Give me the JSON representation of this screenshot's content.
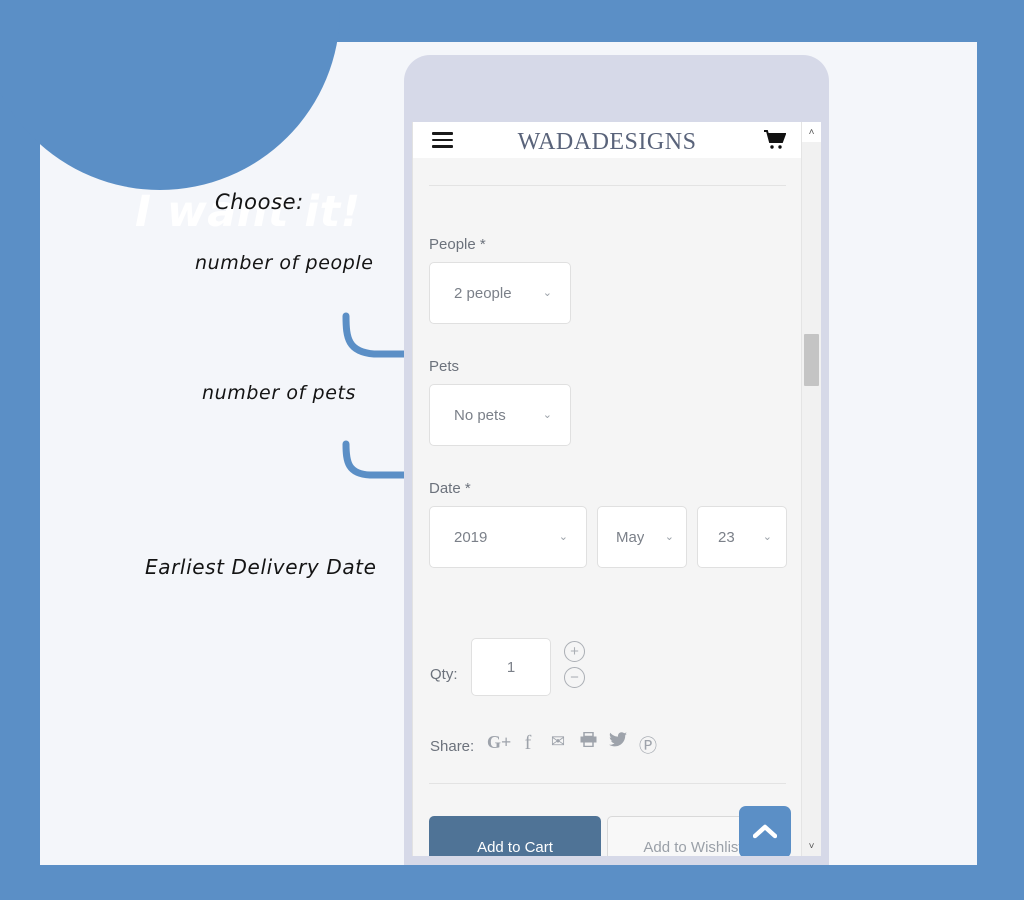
{
  "promo": {
    "bubble_text": "I want it!",
    "bubble_color": "#5B8FC6",
    "panel_color": "#F4F6FA"
  },
  "annotations": [
    {
      "id": "choose",
      "text": "Choose:"
    },
    {
      "id": "people",
      "text": "number of people"
    },
    {
      "id": "pets",
      "text": "number of pets"
    },
    {
      "id": "date",
      "text": "Earliest Delivery Date"
    }
  ],
  "site": {
    "title": "WADADESIGNS",
    "menu_icon": "hamburger-icon",
    "cart_icon": "shopping-cart-icon",
    "title_color": "#59637A"
  },
  "form": {
    "people": {
      "label": "People *",
      "value": "2 people",
      "caret": "⌄"
    },
    "pets": {
      "label": "Pets",
      "value": "No pets",
      "caret": "⌄"
    },
    "date": {
      "label": "Date *",
      "year": "2019",
      "month": "May",
      "day": "23",
      "caret": "⌄"
    },
    "qty": {
      "label": "Qty:",
      "value": "1",
      "increment": "+",
      "decrement": "−"
    },
    "share": {
      "label": "Share:",
      "icons": [
        {
          "name": "google-plus-icon",
          "glyph": "G+"
        },
        {
          "name": "facebook-icon",
          "glyph": "f"
        },
        {
          "name": "email-icon",
          "glyph": "✉"
        },
        {
          "name": "print-icon",
          "glyph": "⎙"
        },
        {
          "name": "twitter-icon",
          "glyph": "ᵥ"
        },
        {
          "name": "pinterest-icon",
          "glyph": "Ⓟ"
        }
      ]
    }
  },
  "actions": {
    "add_to_cart": "Add to Cart",
    "add_to_wishlist": "Add to Wishlist",
    "cart_button_color": "#4F7396",
    "scroll_top_icon": "chevron-up-icon",
    "scroll_top_color": "#5B8FC6"
  },
  "scrollbar": {
    "up_arrow": "˄",
    "down_arrow": "˅"
  }
}
